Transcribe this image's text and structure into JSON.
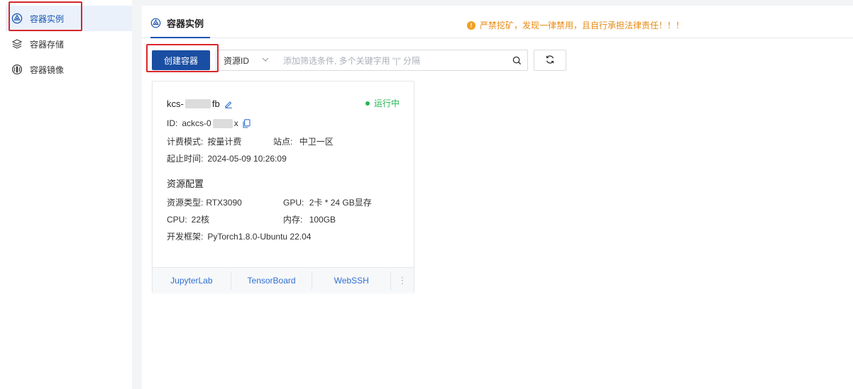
{
  "sidebar": {
    "items": [
      {
        "label": "容器实例",
        "icon": "instance-icon",
        "active": true
      },
      {
        "label": "容器存储",
        "icon": "storage-icon",
        "active": false
      },
      {
        "label": "容器镜像",
        "icon": "image-icon",
        "active": false
      }
    ]
  },
  "tab": {
    "label": "容器实例"
  },
  "warning": {
    "icon": "!",
    "text": "严禁挖矿，发现一律禁用，且自行承担法律责任！！！"
  },
  "toolbar": {
    "create_label": "创建容器",
    "filter_key": "资源ID",
    "filter_placeholder": "添加筛选条件, 多个关键字用 \"|\" 分隔"
  },
  "card": {
    "name_prefix": "kcs-",
    "name_suffix": "fb",
    "status": "运行中",
    "id_label": "ID:",
    "id_prefix": "ackcs-0",
    "id_suffix": "x",
    "billing_label": "计费模式:",
    "billing_value": "按量计费",
    "site_label": "站点:",
    "site_value": "中卫一区",
    "time_label": "起止时间:",
    "time_value": "2024-05-09 10:26:09",
    "section_title": "资源配置",
    "resource_type_label": "资源类型:",
    "resource_type_value": "RTX3090",
    "gpu_label": "GPU:",
    "gpu_value": "2卡 * 24 GB显存",
    "cpu_label": "CPU:",
    "cpu_value": "22核",
    "memory_label": "内存:",
    "memory_value": "100GB",
    "framework_label": "开发框架:",
    "framework_value": "PyTorch1.8.0-Ubuntu 22.04",
    "actions": [
      "JupyterLab",
      "TensorBoard",
      "WebSSH"
    ],
    "more": "⋮"
  },
  "colors": {
    "primary": "#1a4ea3",
    "link": "#2f6fd0",
    "running": "#27b553",
    "warning": "#e88a12",
    "highlight": "#d9262c"
  }
}
